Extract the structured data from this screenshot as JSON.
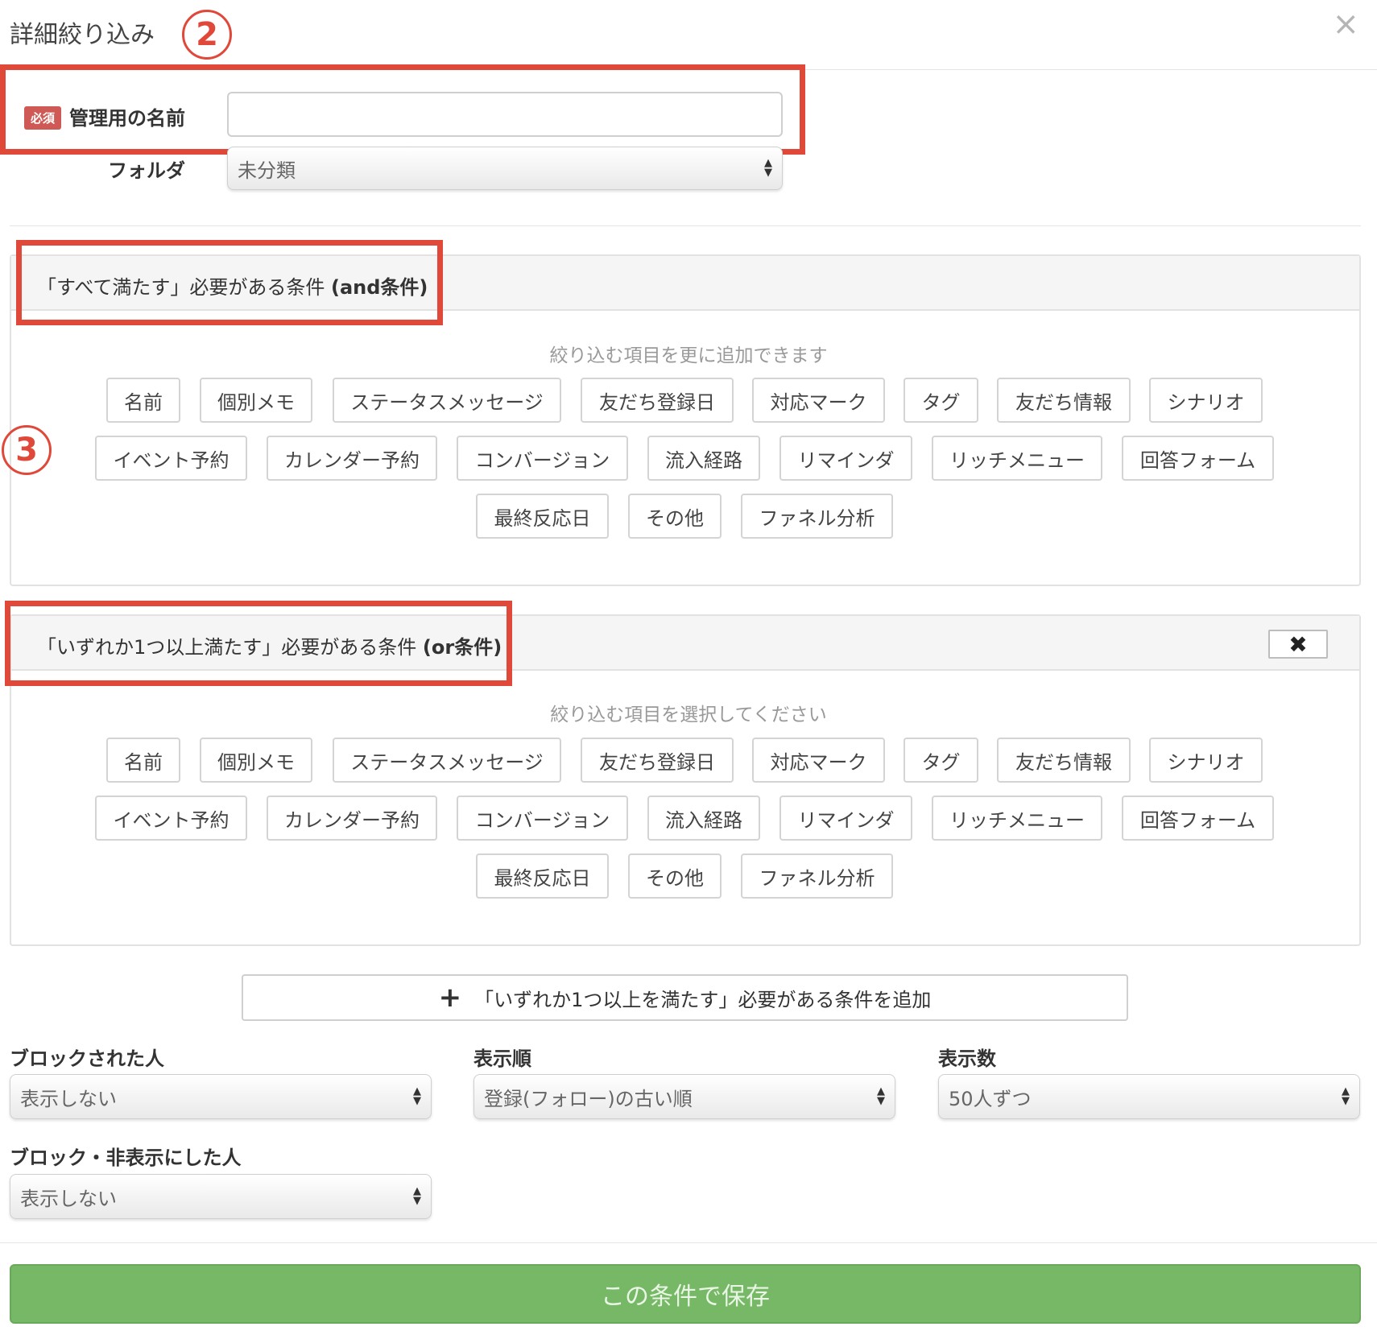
{
  "header": {
    "title": "詳細絞り込み",
    "close": "×"
  },
  "annotations": {
    "step2": "2",
    "step3": "3"
  },
  "form": {
    "required_badge": "必須",
    "name_label": "管理用の名前",
    "name_value": "",
    "folder_label": "フォルダ",
    "folder_value": "未分類"
  },
  "and_panel": {
    "title_text": "「すべて満たす」必要がある条件 ",
    "title_bold": "(and条件)",
    "hint": "絞り込む項目を更に追加できます"
  },
  "or_panel": {
    "title_text": "「いずれか1つ以上満たす」必要がある条件 ",
    "title_bold": "(or条件)",
    "hint": "絞り込む項目を選択してください",
    "remove": "✖"
  },
  "condition_items": [
    "名前",
    "個別メモ",
    "ステータスメッセージ",
    "友だち登録日",
    "対応マーク",
    "タグ",
    "友だち情報",
    "シナリオ",
    "イベント予約",
    "カレンダー予約",
    "コンバージョン",
    "流入経路",
    "リマインダ",
    "リッチメニュー",
    "回答フォーム",
    "最終反応日",
    "その他",
    "ファネル分析"
  ],
  "add_or_button": {
    "icon": "plus-icon",
    "label": "「いずれか1つ以上を満たす」必要がある条件を追加"
  },
  "options": {
    "blocked_label": "ブロックされた人",
    "blocked_value": "表示しない",
    "order_label": "表示順",
    "order_value": "登録(フォロー)の古い順",
    "count_label": "表示数",
    "count_value": "50人ずつ",
    "hidden_label": "ブロック・非表示にした人",
    "hidden_value": "表示しない"
  },
  "save_button": "この条件で保存",
  "colors": {
    "annotation_red": "#e0493a",
    "save_green": "#76b865",
    "required_red": "#cf5a55"
  }
}
